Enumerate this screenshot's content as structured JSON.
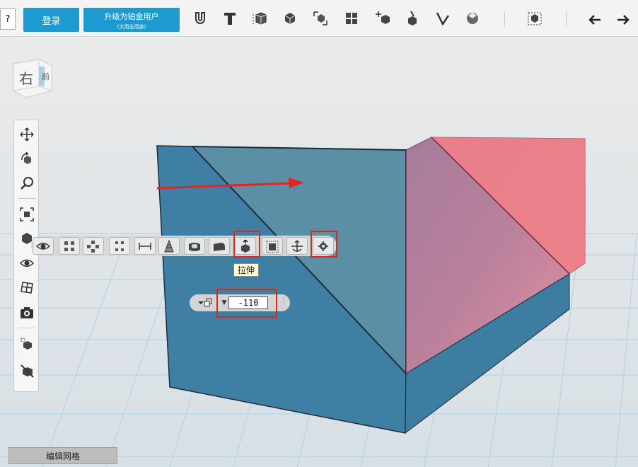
{
  "topbar": {
    "help_label": "?",
    "login_label": "登录",
    "upgrade_label": "升级为铂金用户",
    "upgrade_sublabel": "(大而业用途)",
    "tools": [
      "magnet-icon",
      "text-icon",
      "primitive-icon",
      "combine-icon",
      "construct-icon",
      "pattern-icon",
      "transform-icon",
      "modify-icon",
      "measure-icon",
      "material-icon",
      "group-icon",
      "undo-icon",
      "redo-icon"
    ]
  },
  "viewcube": {
    "face_left": "右",
    "face_right": "前"
  },
  "left_toolbar": [
    "pan-icon",
    "orbit-icon",
    "zoom-icon",
    "fit-icon",
    "view-icon",
    "eye-icon",
    "grid-snap-icon",
    "screenshot-icon",
    "material-icon",
    "hide-icon"
  ],
  "face_toolbar": {
    "buttons": [
      "view-icon",
      "vertex-mode-icon",
      "edge-mode-icon",
      "face-mode-icon",
      "distance-icon",
      "taper-icon",
      "shell-icon",
      "fillet-icon",
      "extrude-icon",
      "offset-icon",
      "move-icon",
      "settings-icon"
    ],
    "active": "extrude-icon",
    "tooltip": "拉伸"
  },
  "extrude": {
    "value": "-110"
  },
  "status": {
    "label": "编辑网格"
  },
  "colors": {
    "accent": "#1d9bd1",
    "highlight": "#e0261d",
    "box_blue": "#3f7fa4",
    "box_red": "#ef8087"
  }
}
